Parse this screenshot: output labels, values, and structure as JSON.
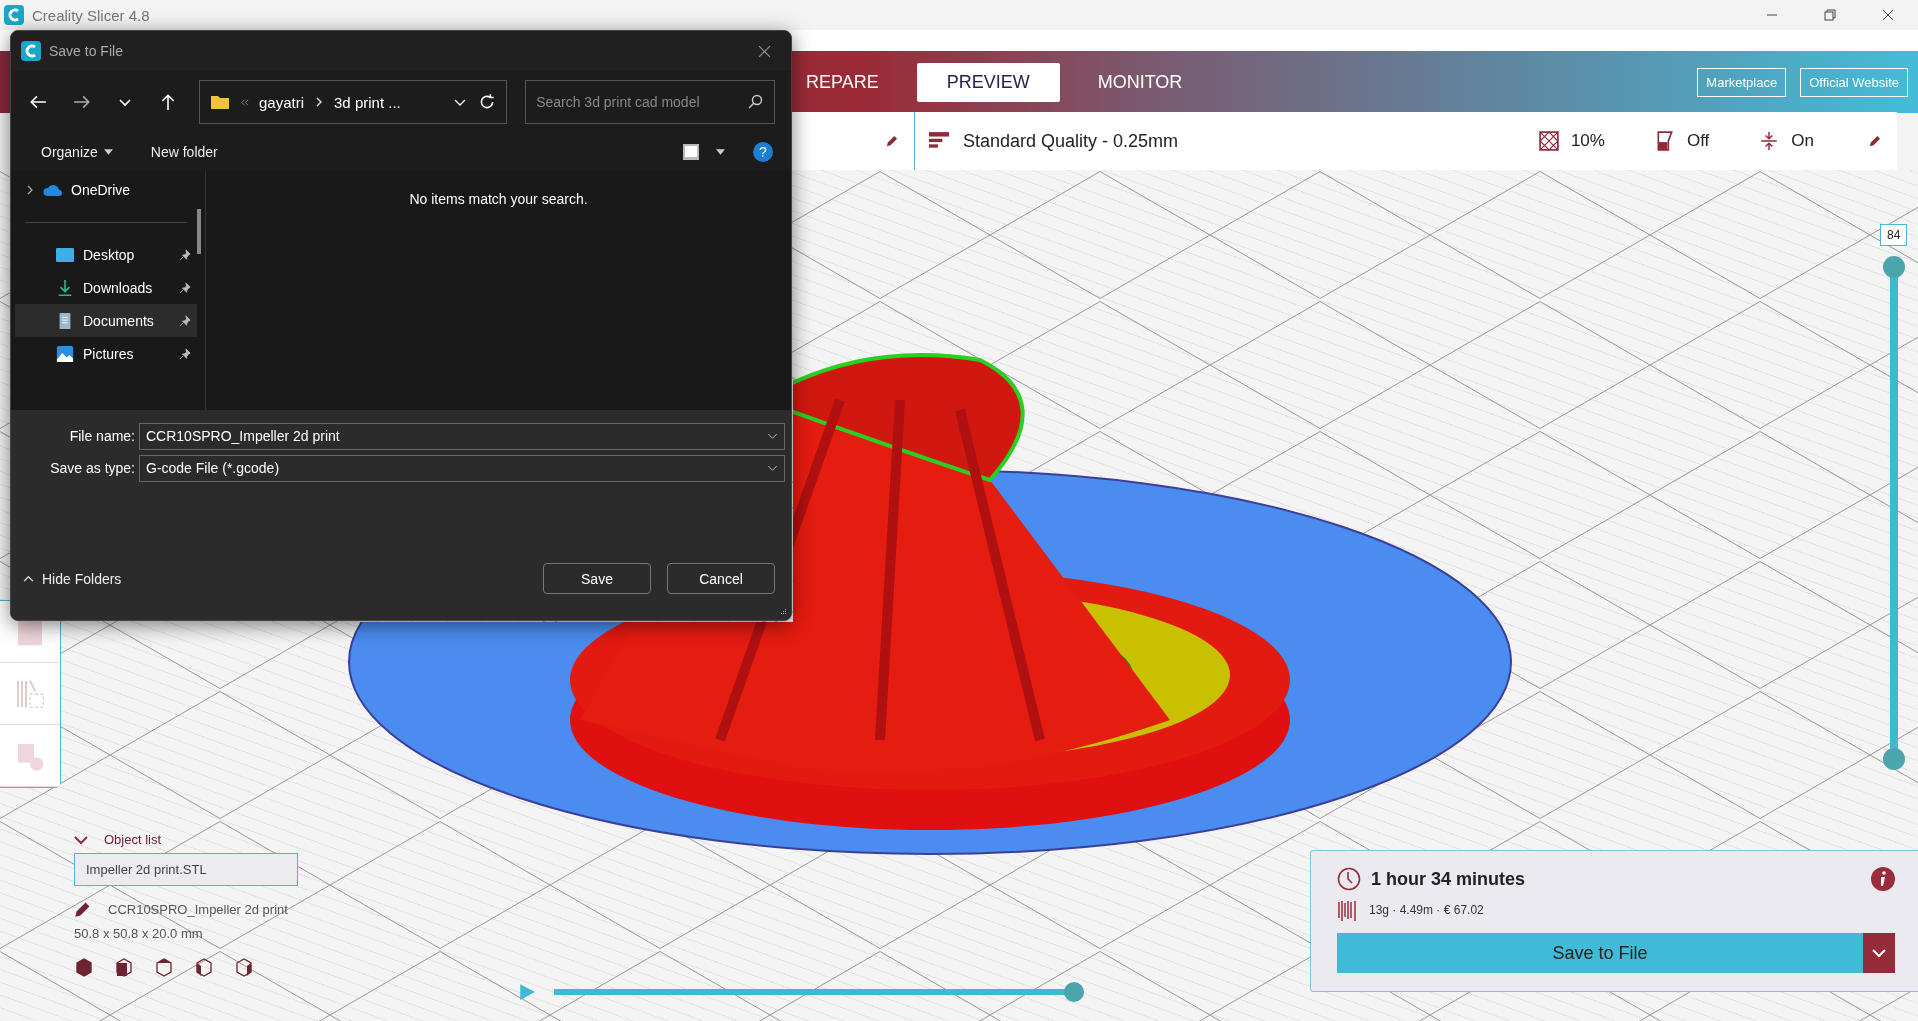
{
  "app": {
    "title": "Creality Slicer 4.8"
  },
  "stages": [
    {
      "label": "REPARE",
      "selected": false
    },
    {
      "label": "PREVIEW",
      "selected": true
    },
    {
      "label": "MONITOR",
      "selected": false
    }
  ],
  "links": [
    "Marketplace",
    "Official Website"
  ],
  "settings": {
    "profile": "Standard Quality - 0.25mm",
    "items": [
      {
        "kind": "infill",
        "value": "10%"
      },
      {
        "kind": "support",
        "value": "Off"
      },
      {
        "kind": "adhesion",
        "value": "On"
      }
    ]
  },
  "dialog": {
    "title": "Save to File",
    "path": [
      "gayatri",
      "3d print ..."
    ],
    "search": {
      "placeholder": "Search 3d print cad model"
    },
    "toolbar": {
      "organize": "Organize",
      "new_folder": "New folder"
    },
    "sidebar": [
      {
        "label": "OneDrive",
        "kind": "cloud",
        "pinned": false,
        "selected": false
      },
      {
        "label": "Desktop",
        "kind": "desktop",
        "pinned": true,
        "selected": false
      },
      {
        "label": "Downloads",
        "kind": "downloads",
        "pinned": true,
        "selected": false
      },
      {
        "label": "Documents",
        "kind": "documents",
        "pinned": true,
        "selected": true
      },
      {
        "label": "Pictures",
        "kind": "pictures",
        "pinned": true,
        "selected": false
      }
    ],
    "empty_message": "No items match your search.",
    "file_name": {
      "label": "File name:",
      "value": "CCR10SPRO_Impeller 2d print"
    },
    "save_type": {
      "label": "Save as type:",
      "value": "G-code File (*.gcode)"
    },
    "help": "?",
    "hide_folders": "Hide Folders",
    "buttons": [
      "Save",
      "Cancel"
    ]
  },
  "object_list": {
    "title": "Object list",
    "expanded": true,
    "items": [
      {
        "name": "Impeller 2d print.STL",
        "selected": true
      }
    ],
    "machine": "CCR10SPRO_Impeller 2d print",
    "dimensions": "50.8 x 50.8 x 20.0 mm"
  },
  "layer_slider": {
    "value": "84",
    "level": 1
  },
  "playback": {
    "level": 1
  },
  "print_info": {
    "time": "1 hour 34 minutes",
    "stats": "13g · 4.49m · € 67.02",
    "button": "Save to File"
  }
}
